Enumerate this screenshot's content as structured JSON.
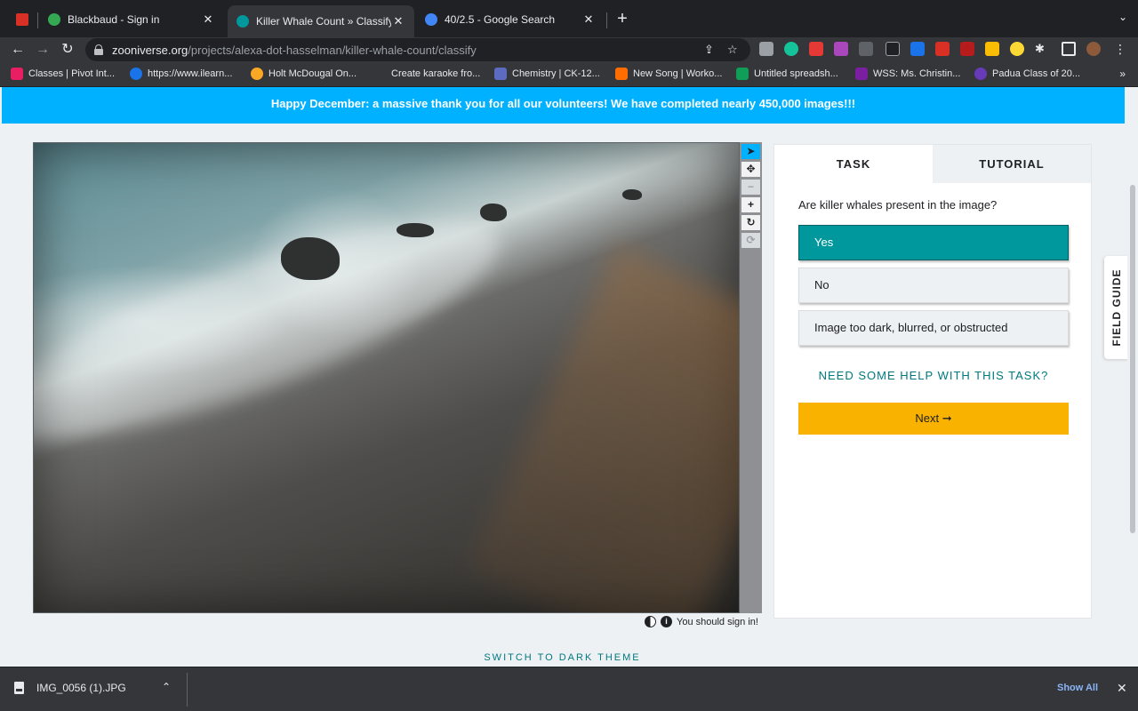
{
  "browser": {
    "tabs": [
      {
        "title": "",
        "favicon_color": "#d93025"
      },
      {
        "title": "Blackbaud - Sign in",
        "favicon_color": "#34a853"
      },
      {
        "title": "Killer Whale Count » Classify –",
        "favicon_color": "#00979d"
      },
      {
        "title": "40/2.5 - Google Search",
        "favicon_color": "#4285f4"
      }
    ],
    "url_host": "zooniverse.org",
    "url_path": "/projects/alexa-dot-hasselman/killer-whale-count/classify",
    "bookmarks": [
      "Classes | Pivot Int...",
      "https://www.ilearn...",
      "Holt McDougal On...",
      "Create karaoke fro...",
      "Chemistry | CK-12...",
      "New Song | Worko...",
      "Untitled spreadsh...",
      "WSS: Ms. Christin...",
      "Padua Class of 20..."
    ]
  },
  "page": {
    "banner": "Happy December: a massive thank you for all our volunteers! We have completed nearly 450,000 images!!!",
    "sign_in_note": "You should sign in!",
    "theme_toggle": "SWITCH TO DARK THEME",
    "field_guide": "FIELD GUIDE"
  },
  "task_panel": {
    "tab_task": "TASK",
    "tab_tutorial": "TUTORIAL",
    "question": "Are killer whales present in the image?",
    "answers": [
      {
        "label": "Yes",
        "selected": true
      },
      {
        "label": "No",
        "selected": false
      },
      {
        "label": "Image too dark, blurred, or obstructed",
        "selected": false
      }
    ],
    "help_link": "NEED SOME HELP WITH THIS TASK?",
    "next_label": "Next ➞"
  },
  "colors": {
    "banner": "#00b1ff",
    "selected_answer": "#00979d",
    "next_button": "#f9b200",
    "link": "#00797e"
  },
  "downloads": {
    "file_name": "IMG_0056 (1).JPG",
    "show_all": "Show All"
  }
}
